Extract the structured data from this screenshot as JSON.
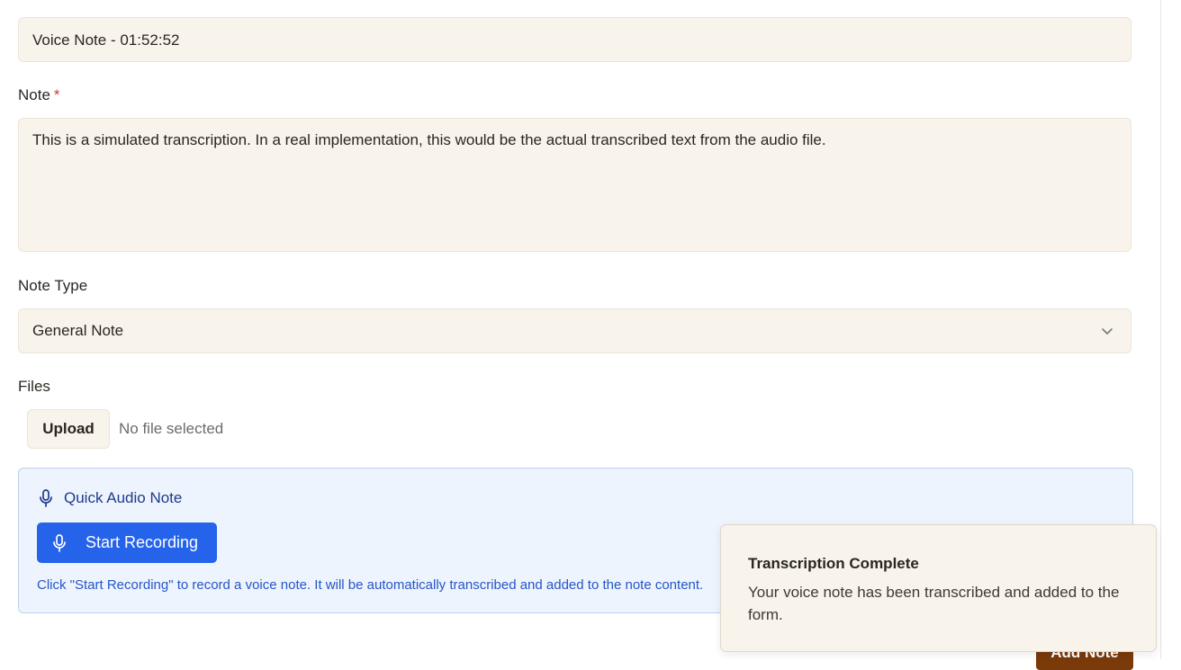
{
  "form": {
    "title_value": "Voice Note - 01:52:52",
    "note_label": "Note",
    "note_required_mark": "*",
    "note_value": "This is a simulated transcription. In a real implementation, this would be the actual transcribed text from the audio file.",
    "note_type_label": "Note Type",
    "note_type_value": "General Note",
    "files_label": "Files",
    "upload_label": "Upload",
    "no_file_text": "No file selected",
    "submit_label": "Add Note"
  },
  "audio": {
    "heading": "Quick Audio Note",
    "record_label": "Start Recording",
    "help_text": "Click \"Start Recording\" to record a voice note. It will be automatically transcribed and added to the note content."
  },
  "toast": {
    "title": "Transcription Complete",
    "message": "Your voice note has been transcribed and added to the form."
  },
  "icons": {
    "audio_heading_icon": "microphone-icon",
    "record_icon": "microphone-icon",
    "select_icon": "chevron-down-icon"
  },
  "colors": {
    "field_bg": "#f8f3eb",
    "primary": "#2563eb",
    "required": "#d63a3a",
    "submit_bg": "#7a3a09"
  }
}
